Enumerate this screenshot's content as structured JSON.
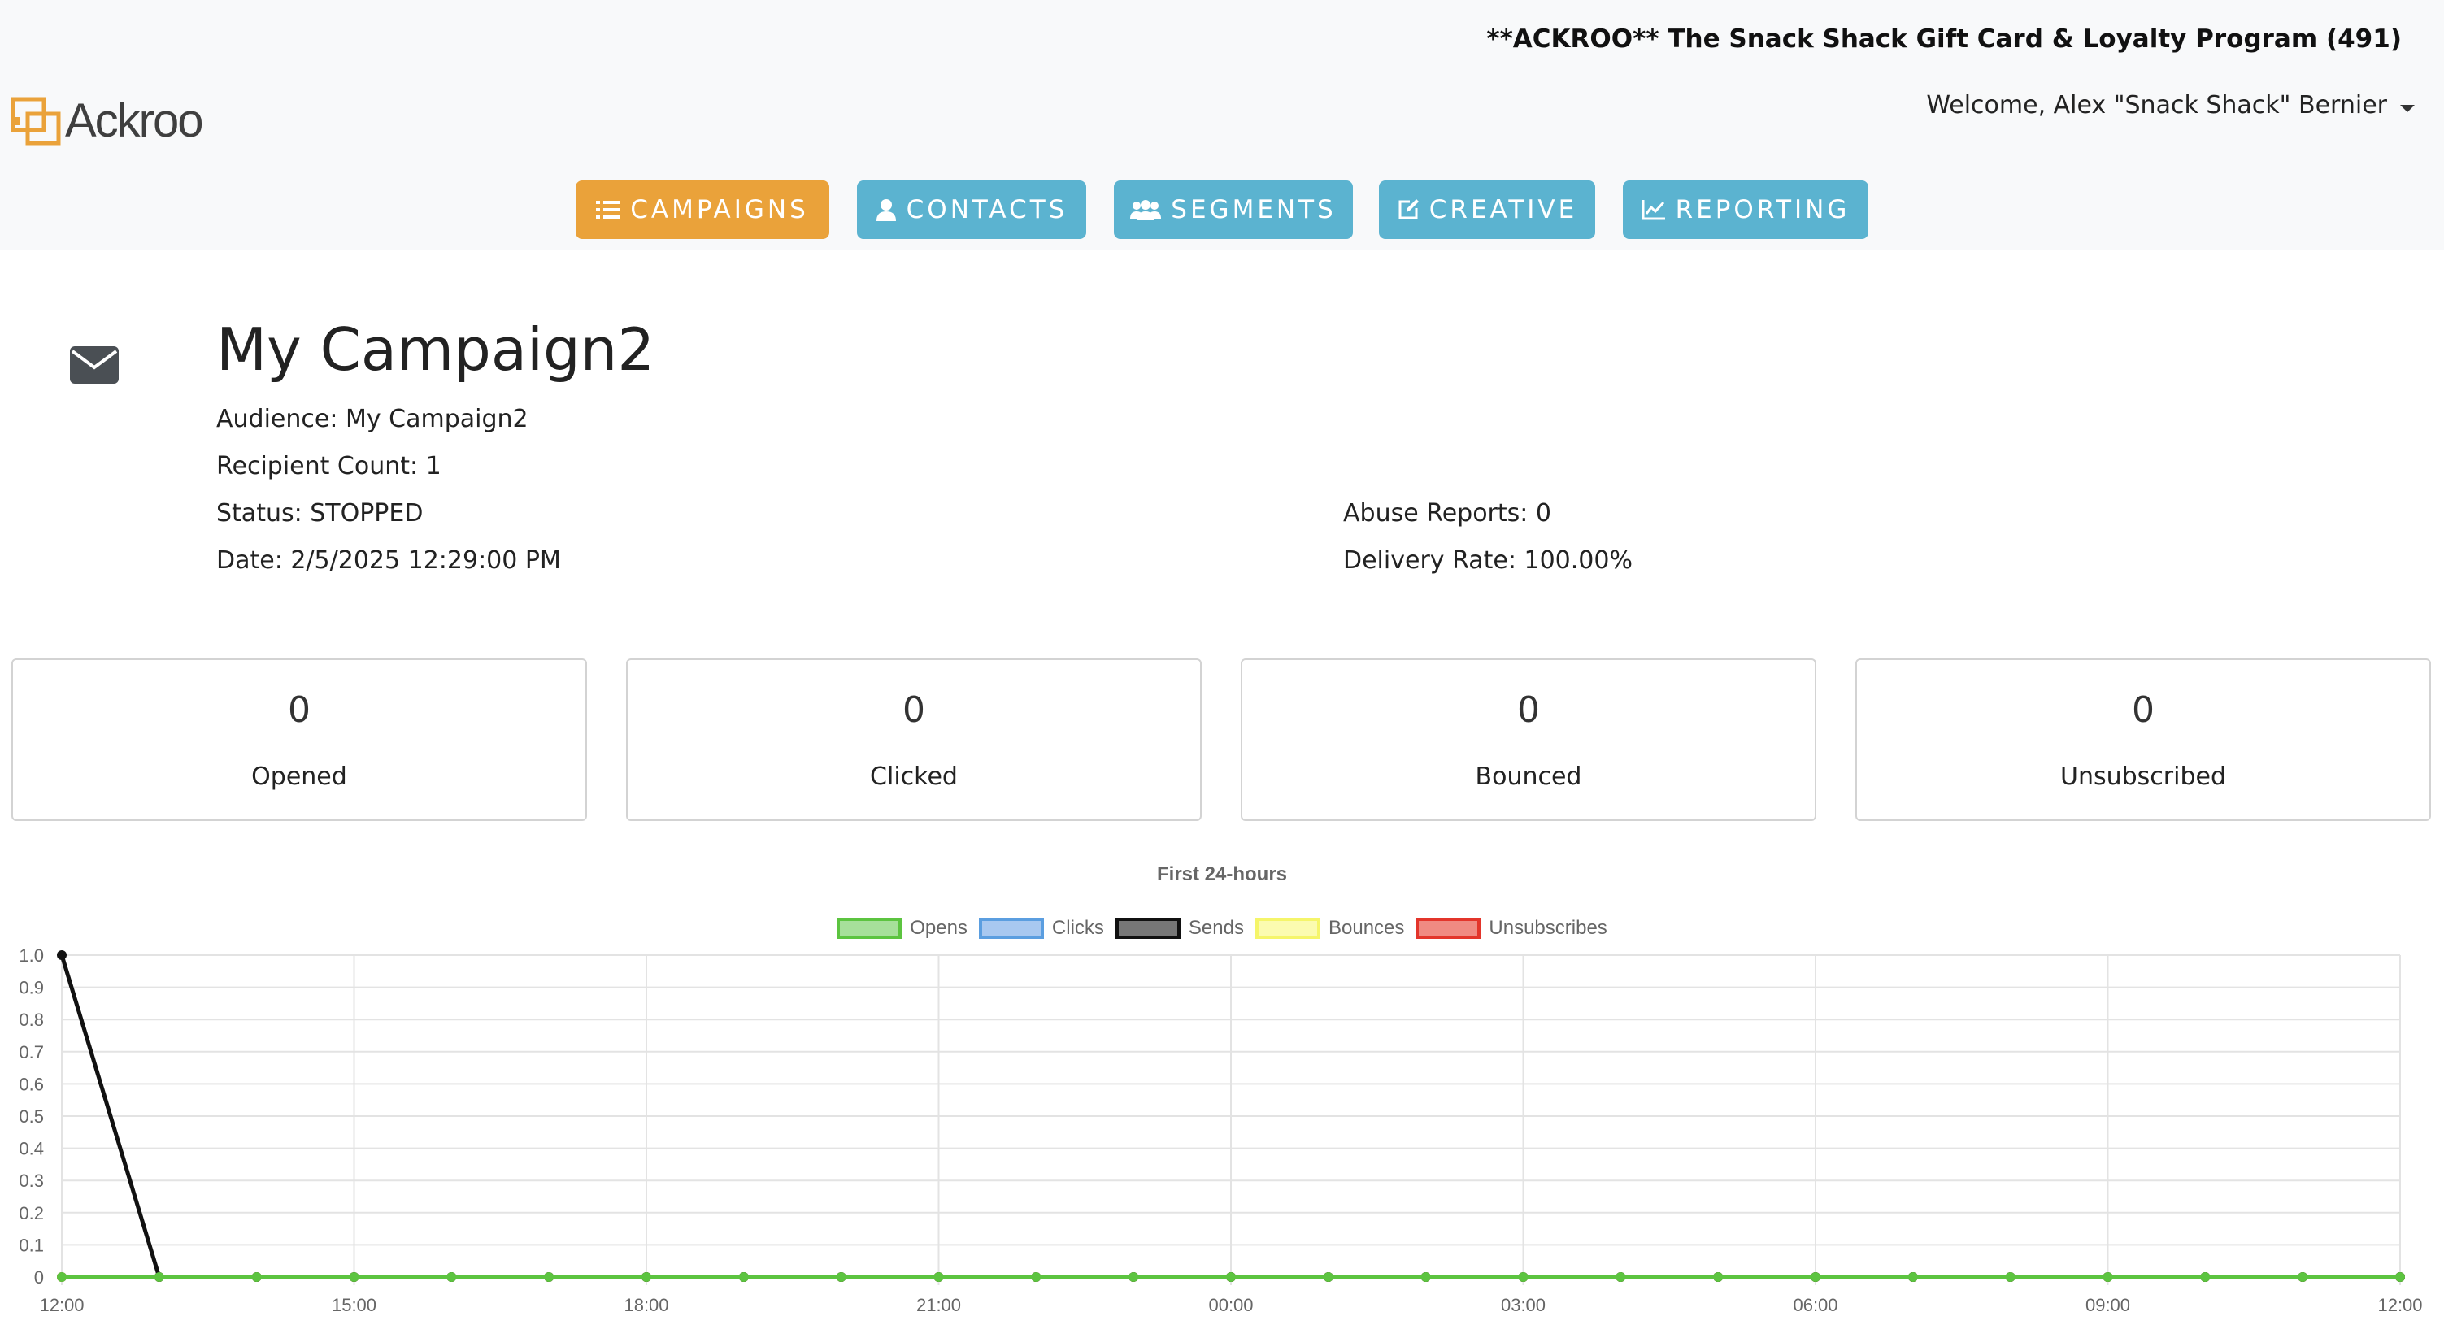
{
  "header": {
    "program": "**ACKROO** The Snack Shack Gift Card & Loyalty Program (491)",
    "welcome": "Welcome, Alex \"Snack Shack\" Bernier",
    "logo_text": "Ackroo",
    "brand_color": "#eaa23a",
    "nav_color": "#5bb3d0"
  },
  "nav": [
    {
      "label": "CAMPAIGNS",
      "icon": "list-icon",
      "active": true
    },
    {
      "label": "CONTACTS",
      "icon": "user-icon",
      "active": false
    },
    {
      "label": "SEGMENTS",
      "icon": "users-icon",
      "active": false
    },
    {
      "label": "CREATIVE",
      "icon": "edit-icon",
      "active": false
    },
    {
      "label": "REPORTING",
      "icon": "line-chart-icon",
      "active": false
    }
  ],
  "campaign": {
    "icon": "envelope-icon",
    "title": "My Campaign2",
    "audience": "Audience: My Campaign2",
    "recipient_count": "Recipient Count: 1",
    "status": "Status: STOPPED",
    "date": "Date: 2/5/2025 12:29:00 PM",
    "abuse_reports": "Abuse Reports: 0",
    "delivery_rate": "Delivery Rate: 100.00%"
  },
  "stats": [
    {
      "value": "0",
      "label": "Opened"
    },
    {
      "value": "0",
      "label": "Clicked"
    },
    {
      "value": "0",
      "label": "Bounced"
    },
    {
      "value": "0",
      "label": "Unsubscribed"
    }
  ],
  "chart_data": {
    "type": "line",
    "title": "First 24-hours",
    "legend_position": "top",
    "grid": true,
    "ylim": [
      0,
      1.0
    ],
    "y_ticks": [
      "0",
      "0.1",
      "0.2",
      "0.3",
      "0.4",
      "0.5",
      "0.6",
      "0.7",
      "0.8",
      "0.9",
      "1.0"
    ],
    "x_tick_labels": [
      "12:00",
      "15:00",
      "18:00",
      "21:00",
      "00:00",
      "03:00",
      "06:00",
      "09:00",
      "12:00"
    ],
    "x": [
      "12:00",
      "13:00",
      "14:00",
      "15:00",
      "16:00",
      "17:00",
      "18:00",
      "19:00",
      "20:00",
      "21:00",
      "22:00",
      "23:00",
      "00:00",
      "01:00",
      "02:00",
      "03:00",
      "04:00",
      "05:00",
      "06:00",
      "07:00",
      "08:00",
      "09:00",
      "10:00",
      "11:00",
      "12:00"
    ],
    "series": [
      {
        "name": "Opens",
        "color": "#5cc440",
        "fill": "#a6e09a",
        "values": [
          0,
          0,
          0,
          0,
          0,
          0,
          0,
          0,
          0,
          0,
          0,
          0,
          0,
          0,
          0,
          0,
          0,
          0,
          0,
          0,
          0,
          0,
          0,
          0,
          0
        ]
      },
      {
        "name": "Clicks",
        "color": "#5b9ee0",
        "fill": "#a8c8f0",
        "values": [
          0,
          0,
          0,
          0,
          0,
          0,
          0,
          0,
          0,
          0,
          0,
          0,
          0,
          0,
          0,
          0,
          0,
          0,
          0,
          0,
          0,
          0,
          0,
          0,
          0
        ]
      },
      {
        "name": "Sends",
        "color": "#111111",
        "fill": "#777777",
        "values": [
          1,
          0,
          0,
          0,
          0,
          0,
          0,
          0,
          0,
          0,
          0,
          0,
          0,
          0,
          0,
          0,
          0,
          0,
          0,
          0,
          0,
          0,
          0,
          0,
          0
        ]
      },
      {
        "name": "Bounces",
        "color": "#f5f56a",
        "fill": "#fbfbb0",
        "values": [
          0,
          0,
          0,
          0,
          0,
          0,
          0,
          0,
          0,
          0,
          0,
          0,
          0,
          0,
          0,
          0,
          0,
          0,
          0,
          0,
          0,
          0,
          0,
          0,
          0
        ]
      },
      {
        "name": "Unsubscribes",
        "color": "#e3352b",
        "fill": "#f08a82",
        "values": [
          0,
          0,
          0,
          0,
          0,
          0,
          0,
          0,
          0,
          0,
          0,
          0,
          0,
          0,
          0,
          0,
          0,
          0,
          0,
          0,
          0,
          0,
          0,
          0,
          0
        ]
      }
    ]
  }
}
